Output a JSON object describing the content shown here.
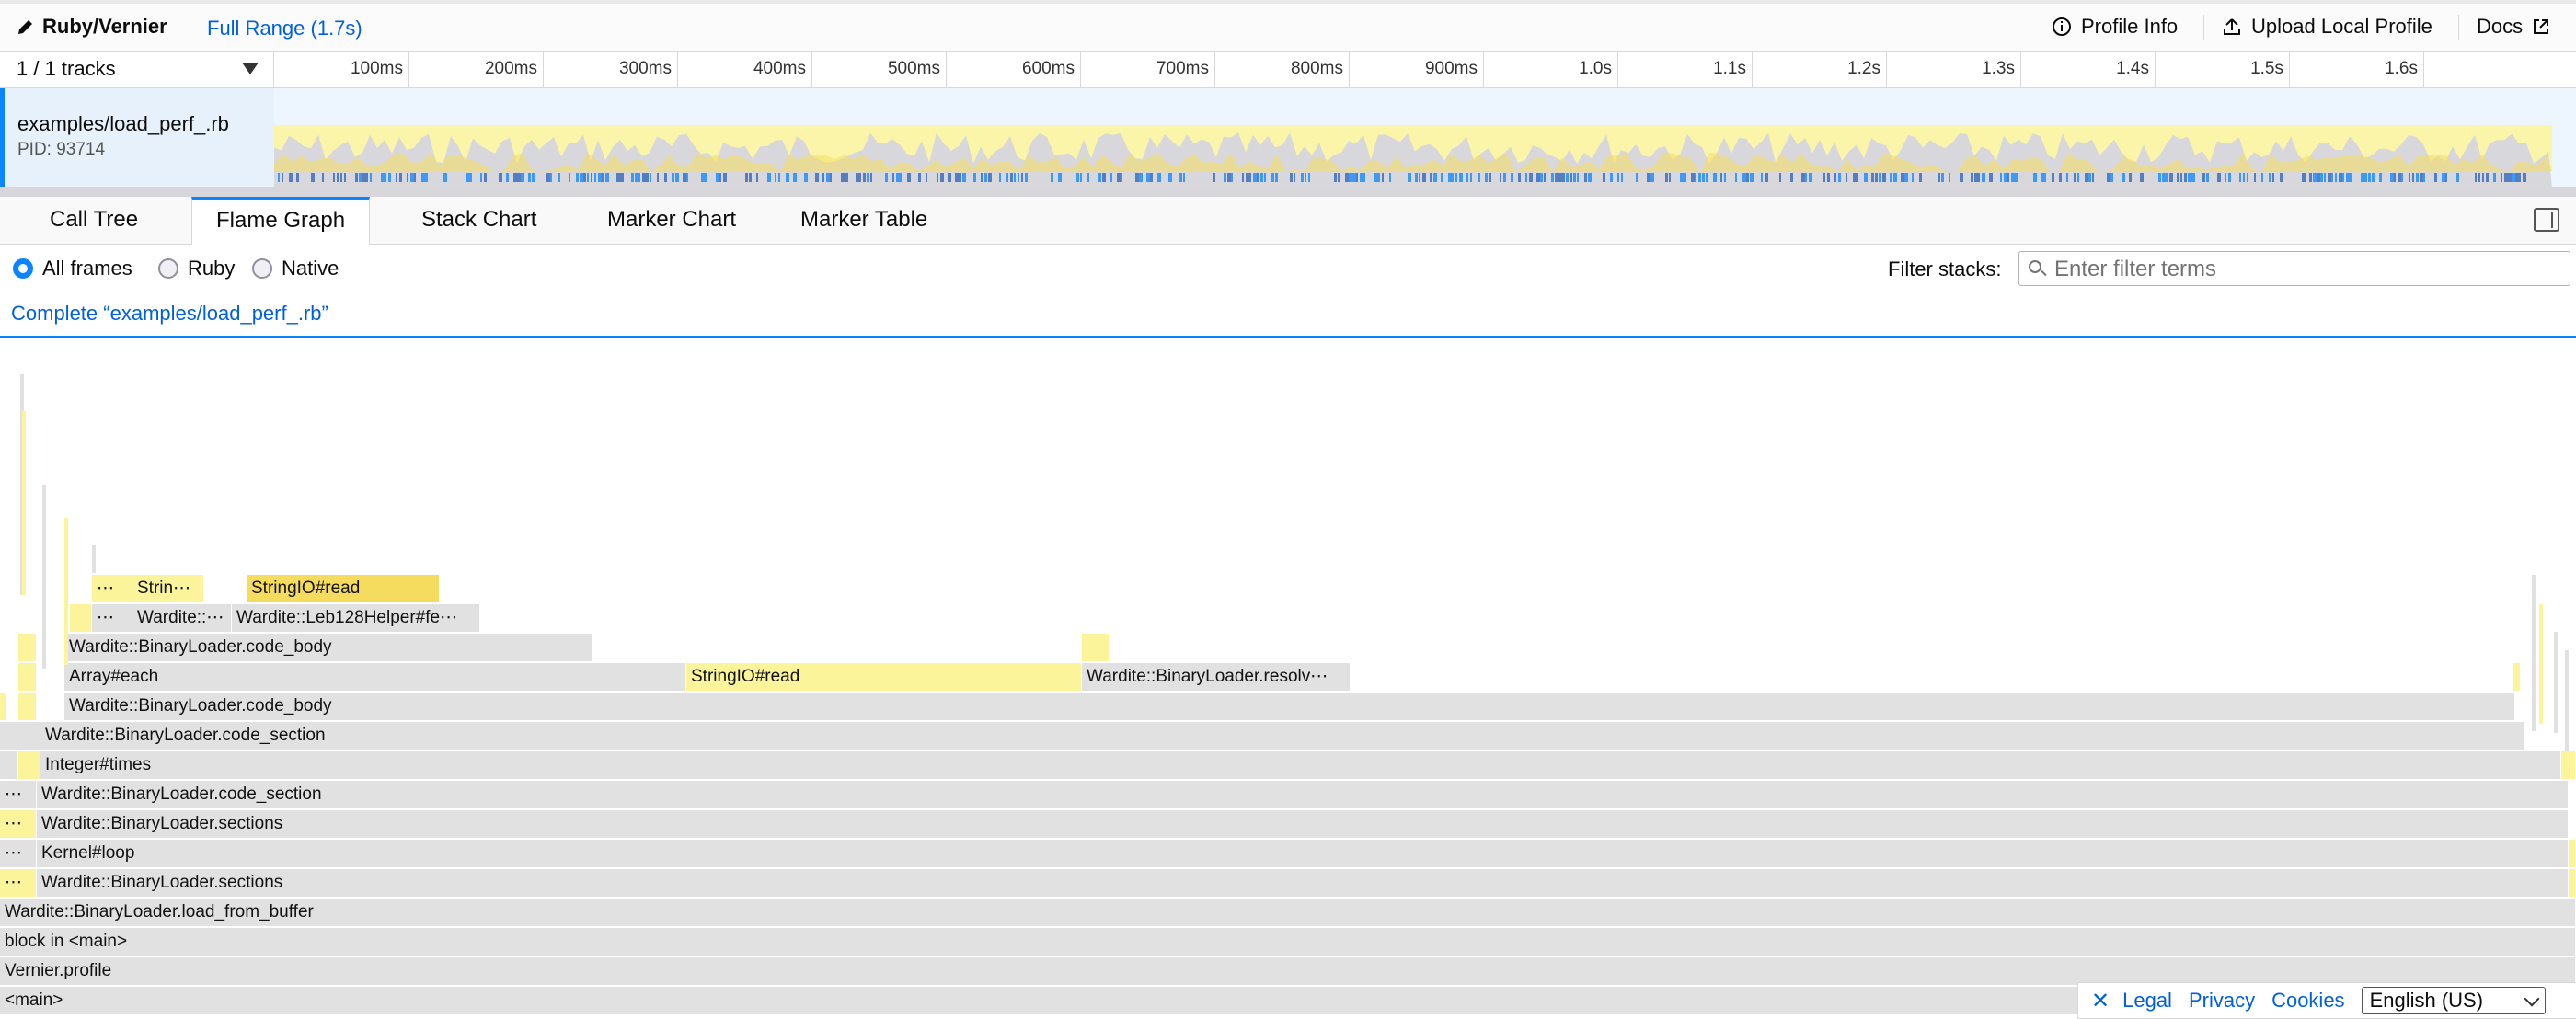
{
  "app": {
    "brand": "Ruby/Vernier",
    "range": "Full Range (1.7s)",
    "profile_info": "Profile Info",
    "upload": "Upload Local Profile",
    "docs": "Docs"
  },
  "timeline": {
    "tracks_count": "1 / 1 tracks",
    "ticks": [
      "100ms",
      "200ms",
      "300ms",
      "400ms",
      "500ms",
      "600ms",
      "700ms",
      "800ms",
      "900ms",
      "1.0s",
      "1.1s",
      "1.2s",
      "1.3s",
      "1.4s",
      "1.5s",
      "1.6s"
    ],
    "track": {
      "name": "examples/load_perf_.rb",
      "pid": "PID: 93714"
    }
  },
  "tabs": [
    "Call Tree",
    "Flame Graph",
    "Stack Chart",
    "Marker Chart",
    "Marker Table"
  ],
  "selected_tab": "Flame Graph",
  "settings": {
    "radios": [
      "All frames",
      "Ruby",
      "Native"
    ],
    "selected": "All frames",
    "filter_label": "Filter stacks:",
    "filter_placeholder": "Enter filter terms",
    "filter_value": ""
  },
  "breadcrumb": "Complete “examples/load_perf_.rb”",
  "flame_frames": {
    "main": "<main>",
    "vernier_profile": "Vernier.profile",
    "block_main": "block in <main>",
    "load_from_buffer": "Wardite::BinaryLoader.load_from_buffer",
    "sections_1": "Wardite::BinaryLoader.sections",
    "kernel_loop": "Kernel#loop",
    "sections_2": "Wardite::BinaryLoader.sections",
    "code_section_1": "Wardite::BinaryLoader.code_section",
    "integer_times": "Integer#times",
    "code_section_2": "Wardite::BinaryLoader.code_section",
    "code_body_1": "Wardite::BinaryLoader.code_body",
    "array_each": "Array#each",
    "stringio_read_1": "StringIO#read",
    "resolve": "Wardite::BinaryLoader.resolv⋯",
    "code_body_2": "Wardite::BinaryLoader.code_body",
    "wardite_trunc": "Wardite::⋯",
    "leb128": "Wardite::Leb128Helper#fe⋯",
    "strin_trunc": "Strin⋯",
    "stringio_read_2": "StringIO#read",
    "ellipsis": "⋯"
  },
  "footer": {
    "close": "✕",
    "legal": "Legal",
    "privacy": "Privacy",
    "cookies": "Cookies",
    "language": "English (US)"
  },
  "colors": {
    "accent": "#0a84ff",
    "js_yellow": "#fbf49a",
    "js_selected": "#f5dc5f",
    "native_grey": "#e1e1e1"
  }
}
